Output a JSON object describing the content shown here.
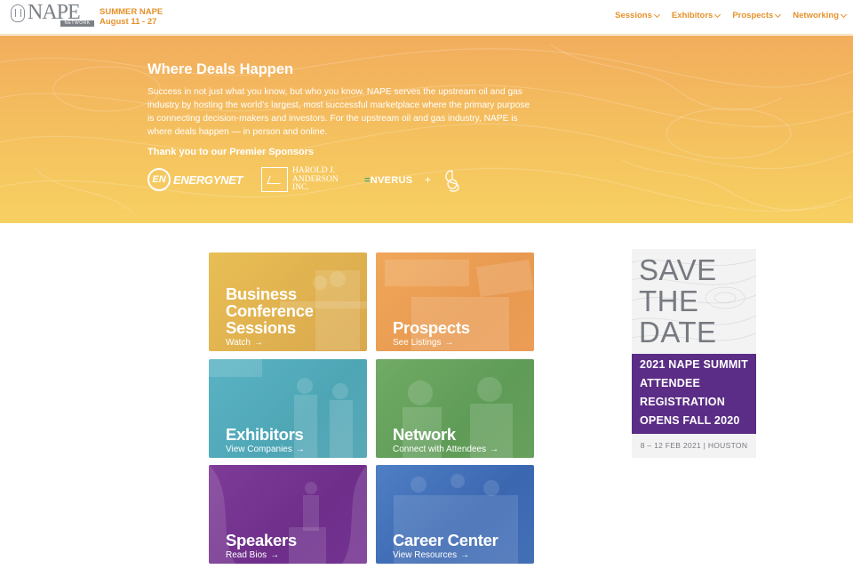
{
  "header": {
    "logo_text": "NAPE",
    "logo_sub": "NETWORK",
    "event_name": "SUMMER NAPE",
    "event_dates": "August 11 - 27",
    "menu": [
      {
        "label": "Sessions"
      },
      {
        "label": "Exhibitors"
      },
      {
        "label": "Prospects"
      },
      {
        "label": "Networking"
      }
    ],
    "accent_color": "#e6922c"
  },
  "hero": {
    "title": "Where Deals Happen",
    "body": "Success in not just what you know, but who you know. NAPE serves the upstream oil and gas industry by hosting the world’s largest, most successful marketplace where the primary purpose is connecting decision-makers and investors. For the upstream oil and gas industry, NAPE is where deals happen — in person and online.",
    "thanks": "Thank you to our Premier Sponsors",
    "sponsors": {
      "energynet_mark": "EN",
      "energynet": "ENERGYNET",
      "harold": "HAROLD J. ANDERSON INC.",
      "enverus": "NVERUS",
      "plus": "+"
    }
  },
  "tiles": [
    {
      "title": "Business Conference Sessions",
      "link": "Watch",
      "color": "#e3b651"
    },
    {
      "title": "Prospects",
      "link": "See Listings",
      "color": "#ee9f55"
    },
    {
      "title": "Exhibitors",
      "link": "View Companies",
      "color": "#55adbf"
    },
    {
      "title": "Network",
      "link": "Connect with Attendees",
      "color": "#67a35d"
    },
    {
      "title": "Speakers",
      "link": "Read Bios",
      "color": "#76358f"
    },
    {
      "title": "Career Center",
      "link": "View Resources",
      "color": "#436eb8"
    }
  ],
  "save_the_date": {
    "big": [
      "SAVE",
      "THE",
      "DATE"
    ],
    "band": [
      "2021 NAPE SUMMIT",
      "ATTENDEE",
      "REGISTRATION",
      "OPENS FALL 2020"
    ],
    "date": "8 – 12 FEB 2021 | HOUSTON",
    "band_color": "#5b2d86"
  }
}
